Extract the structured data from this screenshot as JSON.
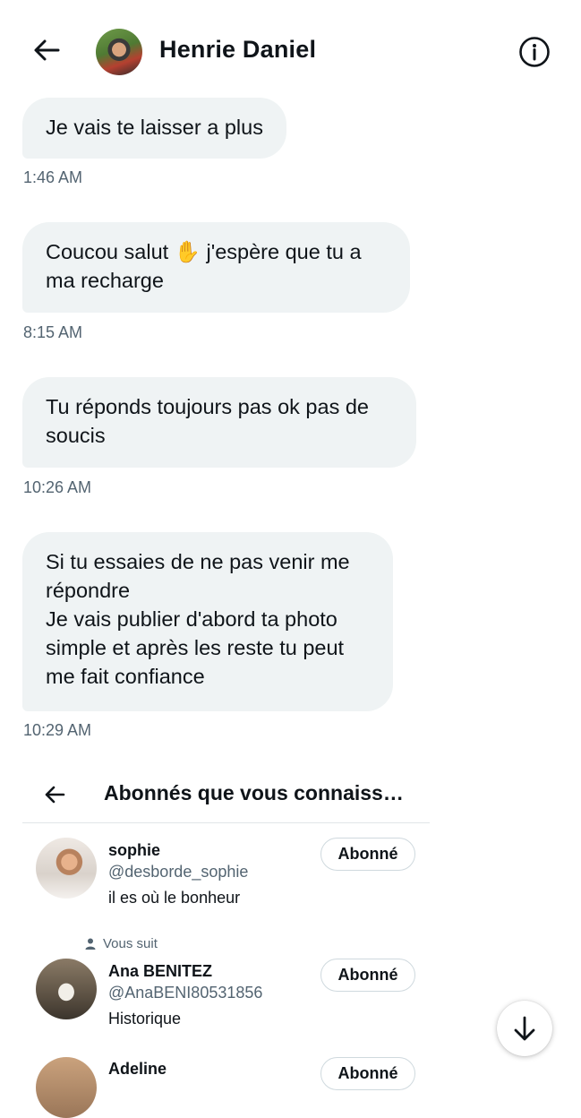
{
  "header": {
    "title": "Henrie Daniel",
    "back_icon": "arrow-left-icon",
    "info_icon": "info-icon"
  },
  "messages": [
    {
      "text": "Je vais te laisser a plus",
      "time": "1:46 AM"
    },
    {
      "text": "Coucou salut ✋ j'espère que tu a\nma recharge",
      "time": "8:15 AM"
    },
    {
      "text": "Tu réponds toujours pas ok pas de\nsoucis",
      "time": "10:26 AM"
    },
    {
      "text": "Si tu essaies de ne pas venir me\nrépondre\nJe vais publier d'abord ta photo\nsimple et après les reste tu peut\nme fait confiance",
      "time": "10:29 AM"
    }
  ],
  "shared_card": {
    "title": "Abonnés que vous connaiss…",
    "users": [
      {
        "name": "sophie",
        "handle": "@desborde_sophie",
        "bio": "il es où le bonheur",
        "button": "Abonné"
      },
      {
        "follows_you": "Vous suit",
        "name": "Ana BENITEZ",
        "handle": "@AnaBENI80531856",
        "bio": "Historique",
        "button": "Abonné"
      },
      {
        "name": "Adeline",
        "button": "Abonné"
      }
    ]
  },
  "scroll_button_icon": "arrow-down-icon",
  "colors": {
    "bubble": "#eff3f4",
    "secondary_text": "#536471",
    "text": "#0f1419"
  }
}
